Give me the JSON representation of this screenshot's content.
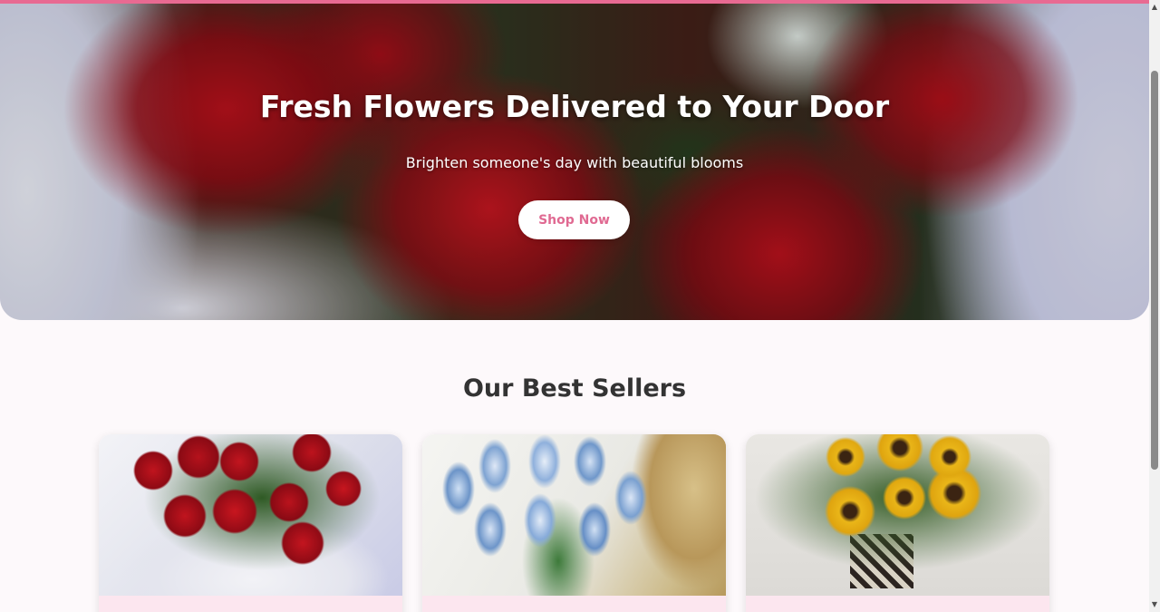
{
  "hero": {
    "title": "Fresh Flowers Delivered to Your Door",
    "subtitle": "Brighten someone's day with beautiful blooms",
    "cta_label": "Shop Now"
  },
  "best_sellers": {
    "title": "Our Best Sellers",
    "products": [
      {
        "image": "red-roses-bouquet"
      },
      {
        "image": "blue-tulips-bouquet"
      },
      {
        "image": "sunflowers-bouquet"
      }
    ]
  },
  "colors": {
    "accent": "#e86a92",
    "background": "#fdf9fb",
    "card_footer": "#fce6ef"
  },
  "scrollbar": {
    "up_icon": "▲",
    "down_icon": "▼"
  }
}
